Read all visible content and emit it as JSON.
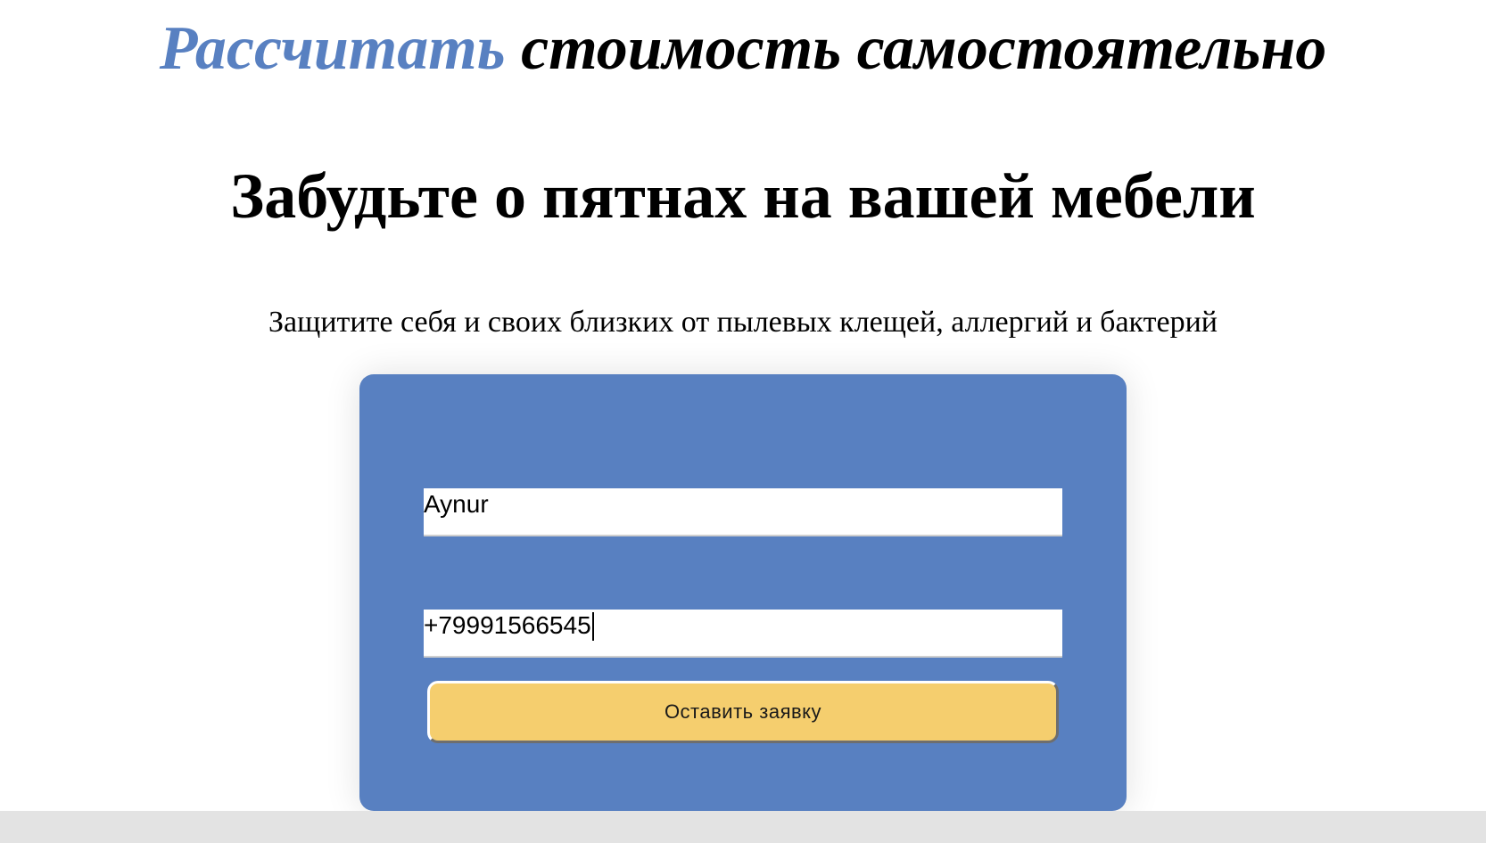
{
  "hero": {
    "title_accent": "Рассчитать",
    "title_rest": " стоимость самостоятельно"
  },
  "headline": "Забудьте о пятнах на вашей мебели",
  "subline": "Защитите себя и своих близких от пылевых клещей, аллергий и бактерий",
  "form": {
    "name_value": "Aynur",
    "phone_value": "+79991566545",
    "submit_label": "Оставить заявку"
  },
  "colors": {
    "accent": "#5880c1",
    "button": "#f5ce6e",
    "footer": "#e3e3e3"
  }
}
